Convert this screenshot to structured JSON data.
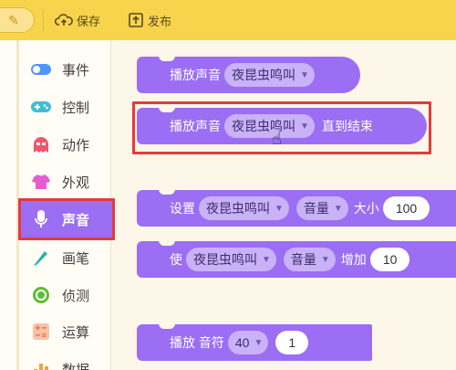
{
  "toolbar": {
    "save_label": "保存",
    "publish_label": "发布"
  },
  "sidebar": {
    "items": [
      {
        "label": "事件",
        "icon": "toggle-icon",
        "color": "#4c97ff"
      },
      {
        "label": "控制",
        "icon": "gamepad-icon",
        "color": "#42bcd7"
      },
      {
        "label": "动作",
        "icon": "ghost-icon",
        "color": "#f0556c"
      },
      {
        "label": "外观",
        "icon": "shirt-icon",
        "color": "#e55cd1"
      },
      {
        "label": "声音",
        "icon": "microphone-icon",
        "color": "#9b6ef3",
        "active": true
      },
      {
        "label": "画笔",
        "icon": "pen-icon",
        "color": "#23b89a"
      },
      {
        "label": "侦测",
        "icon": "target-icon",
        "color": "#5cbf32"
      },
      {
        "label": "运算",
        "icon": "calculator-icon",
        "color": "#ef9a74"
      },
      {
        "label": "数据",
        "icon": "data-icon",
        "color": "#f0a43a"
      }
    ]
  },
  "blocks": {
    "b1": {
      "label": "播放声音",
      "sound": "夜昆虫鸣叫"
    },
    "b2": {
      "label": "播放声音",
      "sound": "夜昆虫鸣叫",
      "suffix": "直到结束"
    },
    "b3": {
      "label": "设置",
      "sound": "夜昆虫鸣叫",
      "effect": "音量",
      "mid": "大小",
      "value": "100"
    },
    "b4": {
      "label": "使",
      "sound": "夜昆虫鸣叫",
      "effect": "音量",
      "mid": "增加",
      "value": "10"
    },
    "b5": {
      "label": "播放 音符",
      "note": "40",
      "beats": "1"
    }
  },
  "colors": {
    "block": "#9b6ef3",
    "dropdown": "#c9b2f8",
    "highlight": "#e33b3b",
    "topbar": "#f7d44c"
  }
}
